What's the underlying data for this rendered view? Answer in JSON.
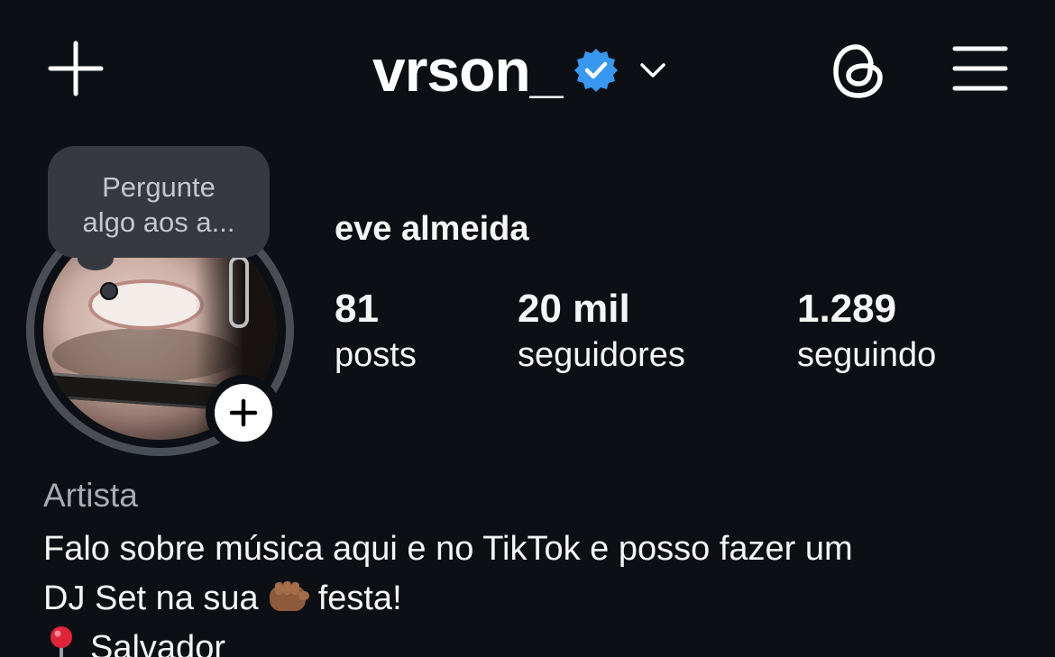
{
  "header": {
    "username": "vrson_",
    "verified": true,
    "icons": {
      "new_post": "plus-icon",
      "verified": "verified-badge-icon",
      "account_switch": "chevron-down-icon",
      "threads": "threads-icon",
      "menu": "hamburger-menu-icon"
    }
  },
  "note": {
    "text_line1": "Pergunte",
    "text_line2": "algo aos a..."
  },
  "profile": {
    "full_name": "eve almeida",
    "stats": [
      {
        "value": "81",
        "label": "posts"
      },
      {
        "value": "20 mil",
        "label": "seguidores"
      },
      {
        "value": "1.289",
        "label": "seguindo"
      }
    ]
  },
  "bio": {
    "category": "Artista",
    "line1": "Falo sobre música aqui e no TikTok e posso fazer um",
    "line2_before": "DJ Set na sua",
    "line2_emoji": "fist-emoji",
    "line2_after": "festa!",
    "location_icon": "pin-icon",
    "location": "Salvador"
  },
  "colors": {
    "background": "#0c1014",
    "verified_blue": "#3897f0",
    "text": "#f5f5f5",
    "muted": "#a8abb0",
    "note_bg": "#363a40"
  }
}
